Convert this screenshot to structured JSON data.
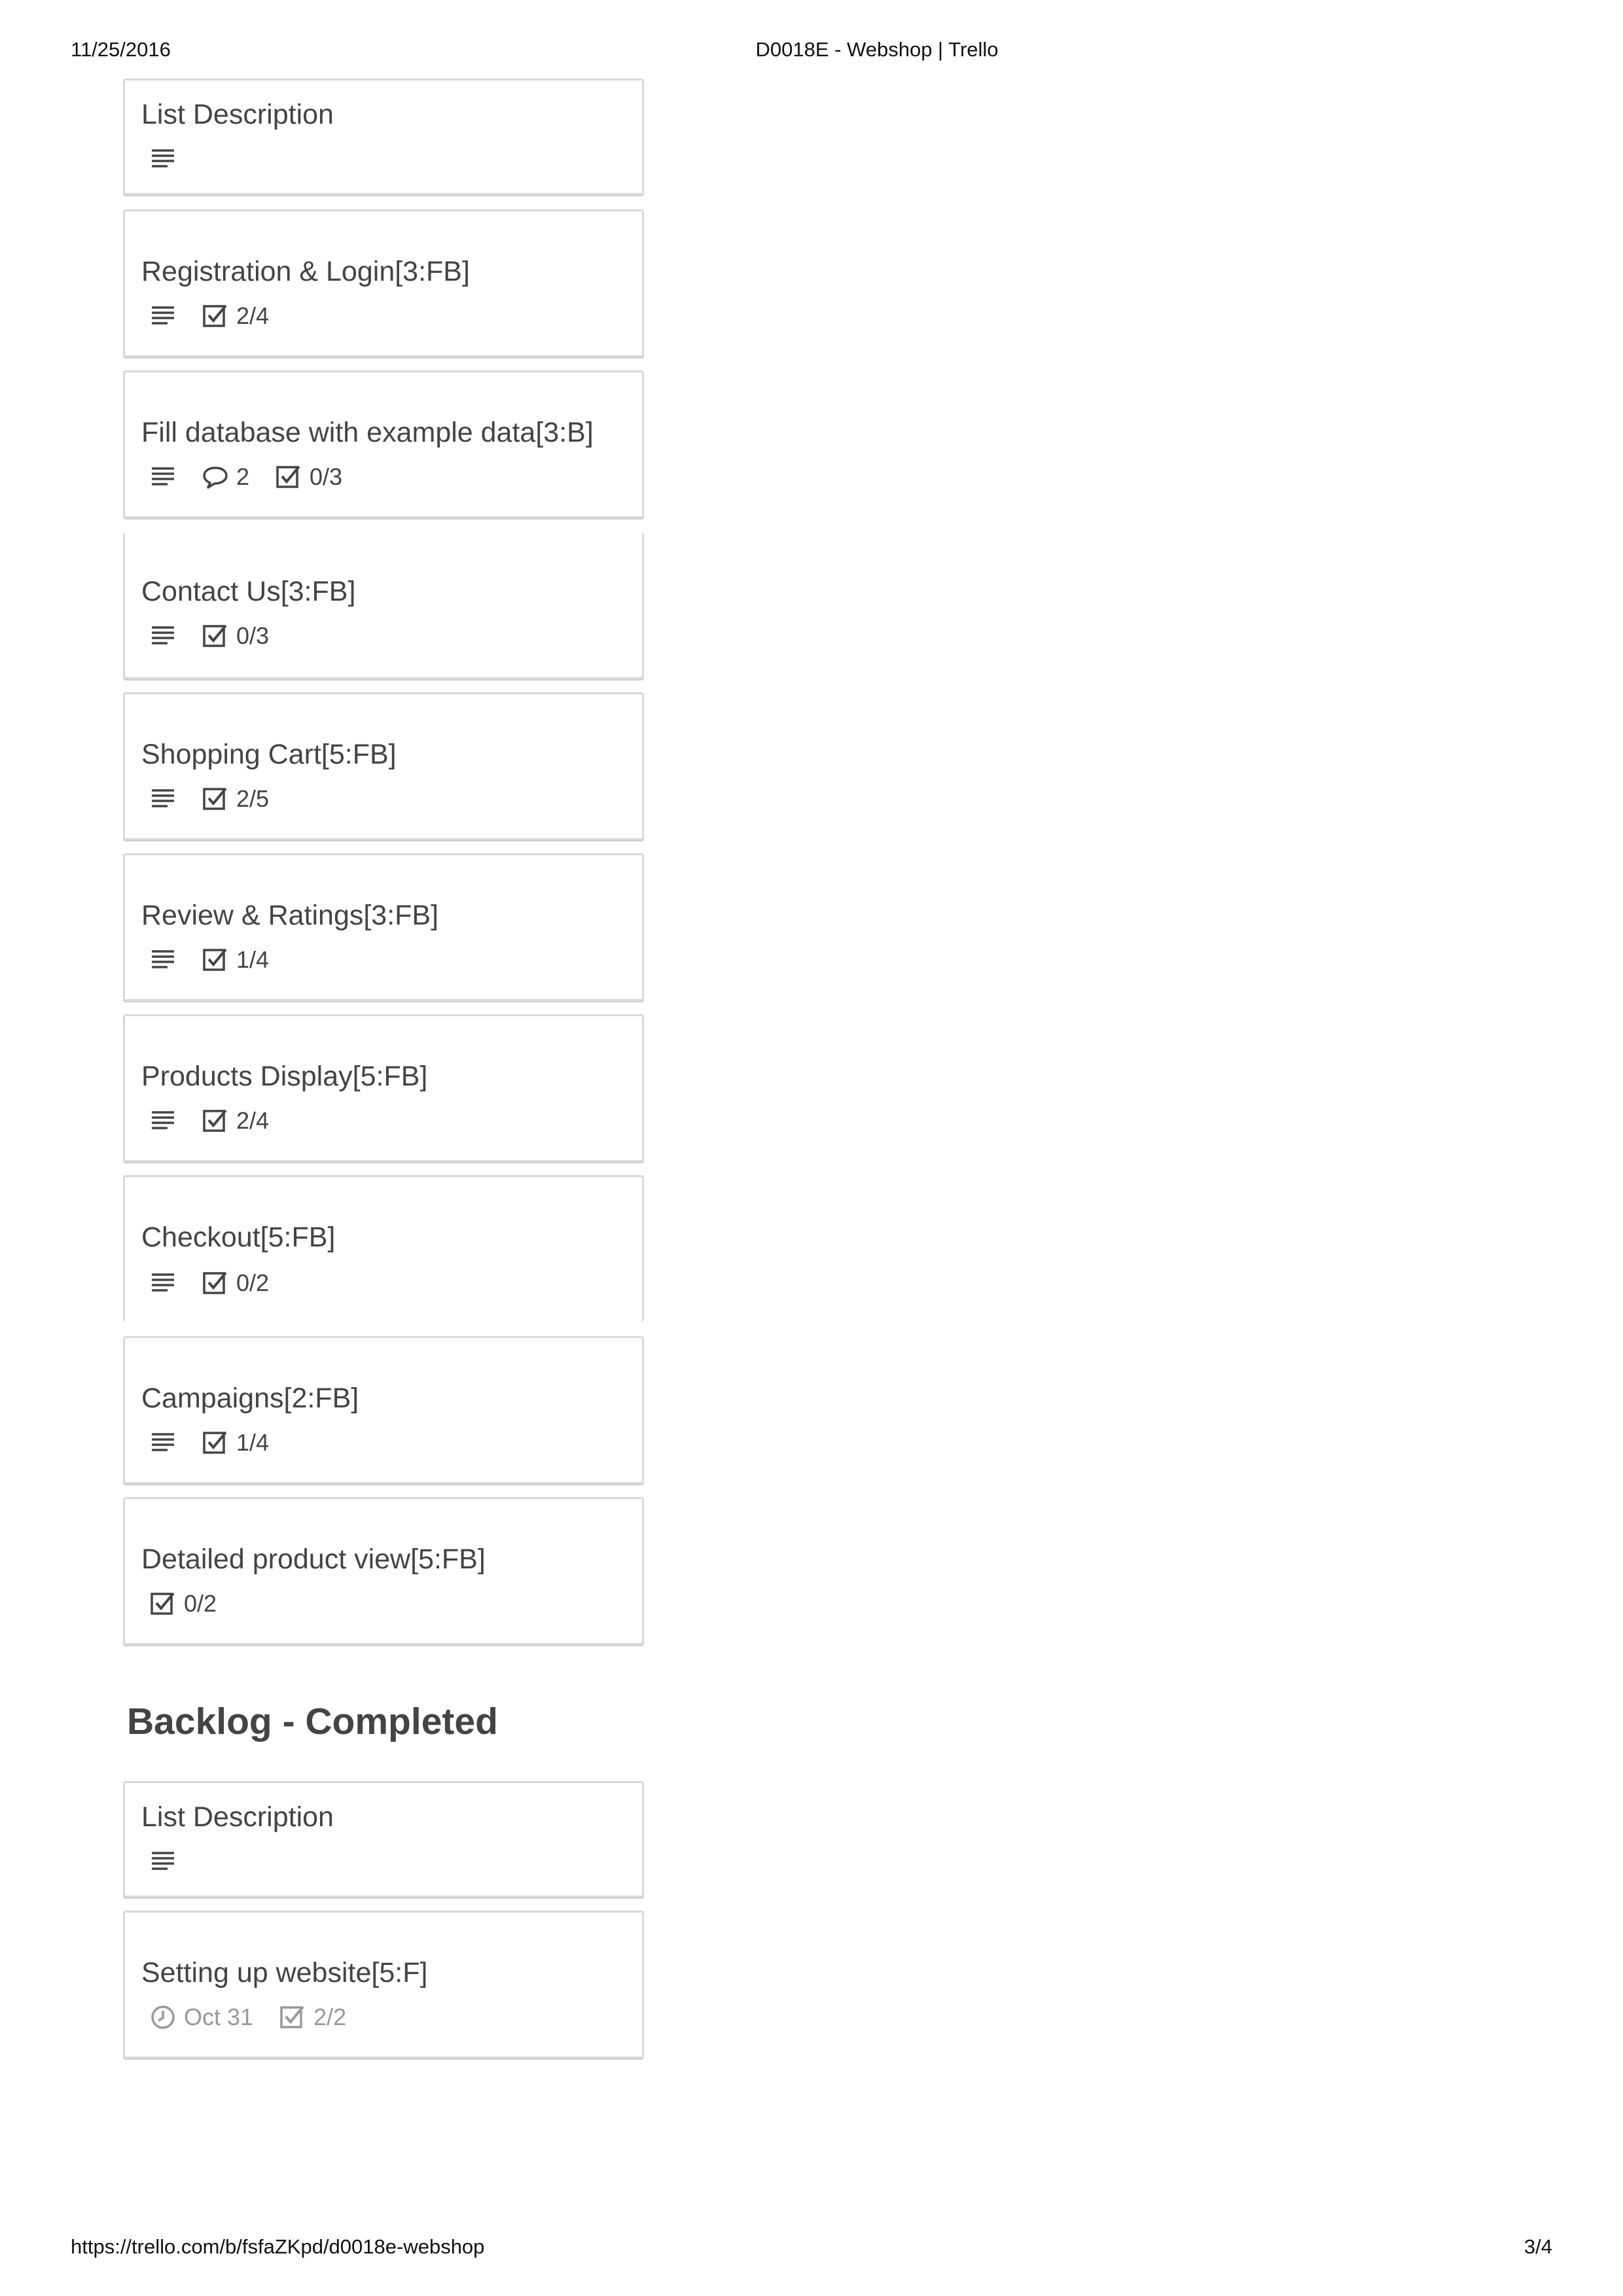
{
  "print_header": {
    "date": "11/25/2016",
    "title": "D0018E - Webshop | Trello"
  },
  "print_footer": {
    "url": "https://trello.com/b/fsfaZKpd/d0018e-webshop",
    "page": "3/4"
  },
  "icons": {
    "description": "description-lines-icon",
    "checklist": "checkbox-checked-icon",
    "comments": "speech-bubble-icon",
    "due_date": "clock-icon"
  },
  "colors": {
    "card_border": "#d9d9d9",
    "text": "#444444",
    "muted": "#999999"
  },
  "list1": {
    "cards": [
      {
        "title": "List Description",
        "checklist": ""
      },
      {
        "title": "Registration & Login[3:FB]",
        "checklist": "2/4"
      },
      {
        "title": "Fill database with example data[3:B]",
        "comments": "2",
        "checklist": "0/3"
      },
      {
        "title": "Contact Us[3:FB]",
        "checklist": "0/3"
      },
      {
        "title": "Shopping Cart[5:FB]",
        "checklist": "2/5"
      },
      {
        "title": "Review & Ratings[3:FB]",
        "checklist": "1/4"
      },
      {
        "title": "Products Display[5:FB]",
        "checklist": "2/4"
      },
      {
        "title": "Checkout[5:FB]",
        "checklist": "0/2"
      },
      {
        "title": "Campaigns[2:FB]",
        "checklist": "1/4"
      },
      {
        "title": "Detailed product view[5:FB]",
        "checklist": "0/2"
      }
    ]
  },
  "backlog_completed": {
    "heading": "Backlog - Completed",
    "cards": [
      {
        "title": "List Description"
      },
      {
        "title": "Setting up website[5:F]",
        "due": "Oct 31",
        "checklist": "2/2"
      }
    ]
  }
}
